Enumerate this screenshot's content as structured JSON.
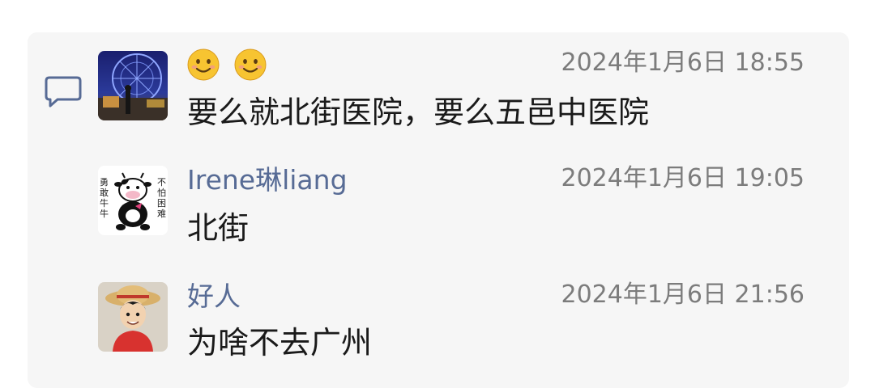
{
  "comments": [
    {
      "author_emojis": [
        "smiling-face-emoji",
        "smiling-face-emoji"
      ],
      "time": "2024年1月6日 18:55",
      "text": "要么就北街医院，要么五邑中医院"
    },
    {
      "author": "Irene琳liang",
      "time": "2024年1月6日 19:05",
      "text": "北街",
      "avatar_text_left": "勇敢牛牛",
      "avatar_text_right": "不怕困难"
    },
    {
      "author": "好人",
      "time": "2024年1月6日 21:56",
      "text": "为啥不去广州"
    }
  ],
  "colors": {
    "author_link": "#576b95",
    "card_bg": "#f6f6f6",
    "time_gray": "#7c7c7c"
  }
}
